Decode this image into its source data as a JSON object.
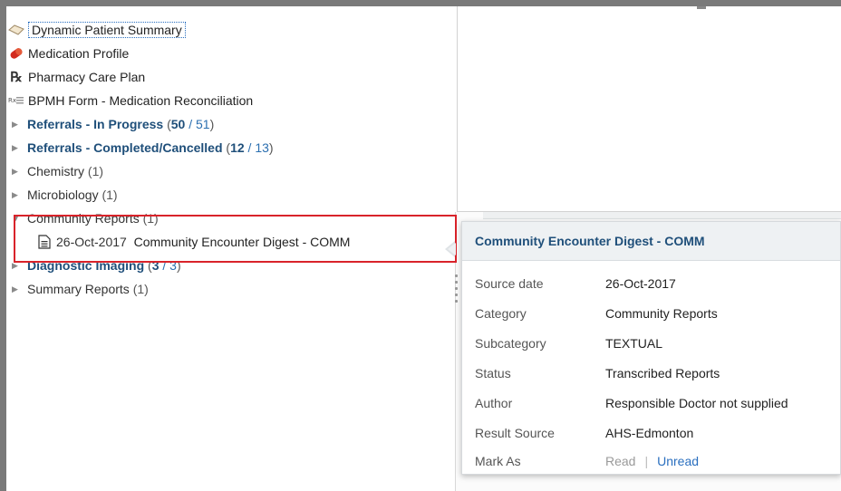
{
  "tree": {
    "dynamic_summary": "Dynamic Patient Summary",
    "medication_profile": "Medication Profile",
    "pharmacy_care_plan": "Pharmacy Care Plan",
    "bpmh_form": "BPMH Form - Medication Reconciliation",
    "referrals_in_progress": {
      "label": "Referrals - In Progress",
      "open": "(",
      "new_count": "50",
      "sep": " / ",
      "total": "51",
      "close": ")"
    },
    "referrals_completed": {
      "label": "Referrals - Completed/Cancelled",
      "open": "(",
      "new_count": "12",
      "sep": " / ",
      "total": "13",
      "close": ")"
    },
    "chemistry": {
      "label": "Chemistry",
      "count": "(1)"
    },
    "microbiology": {
      "label": "Microbiology",
      "count": "(1)"
    },
    "community_reports": {
      "label": "Community Reports",
      "count": "(1)"
    },
    "community_item": {
      "date": "26-Oct-2017",
      "title": "Community Encounter Digest - COMM"
    },
    "diagnostic_imaging": {
      "label": "Diagnostic Imaging",
      "open": "(",
      "new_count": "3",
      "sep": " / ",
      "total": "3",
      "close": ")"
    },
    "summary_reports": {
      "label": "Summary Reports",
      "count": "(1)"
    }
  },
  "popup": {
    "title": "Community Encounter Digest - COMM",
    "rows": [
      {
        "label": "Source date",
        "value": "26-Oct-2017"
      },
      {
        "label": "Category",
        "value": "Community Reports"
      },
      {
        "label": "Subcategory",
        "value": "TEXTUAL"
      },
      {
        "label": "Status",
        "value": "Transcribed Reports"
      },
      {
        "label": "Author",
        "value": "Responsible Doctor not supplied"
      },
      {
        "label": "Result Source",
        "value": "AHS-Edmonton"
      }
    ],
    "mark_as": {
      "label": "Mark As",
      "read": "Read",
      "separator": "|",
      "unread": "Unread"
    }
  },
  "colors": {
    "highlight_border": "#d9232a",
    "link": "#2a6fbf",
    "bold_link": "#1f4f7a"
  },
  "icons": [
    "dynamic-summary-icon",
    "pill-icon",
    "rx-icon",
    "form-icon",
    "expand-arrow-icon",
    "collapse-arrow-icon",
    "document-icon"
  ]
}
